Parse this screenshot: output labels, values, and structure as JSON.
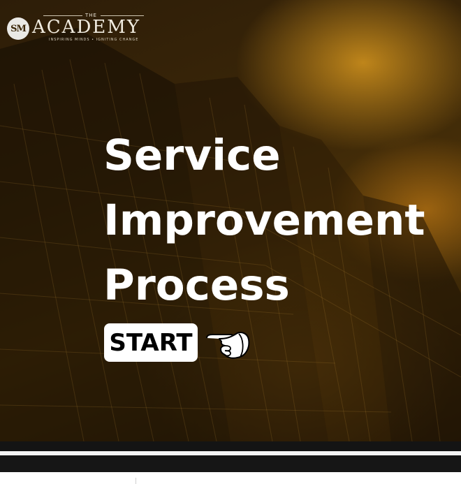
{
  "logo": {
    "badge": "SM",
    "the": "THE",
    "name": "ACADEMY",
    "tagline": "INSPIRING MINDS • IGNITING CHANGE"
  },
  "hero": {
    "title_lines": [
      "Service",
      "Improvement",
      "Process"
    ],
    "start_label": "START"
  },
  "colors": {
    "title": "#ffffff",
    "button_bg": "#ffffff",
    "button_text": "#000000",
    "overlay_gold": "#d6961e"
  },
  "icons": {
    "pointer": "pointing-hand-icon"
  }
}
